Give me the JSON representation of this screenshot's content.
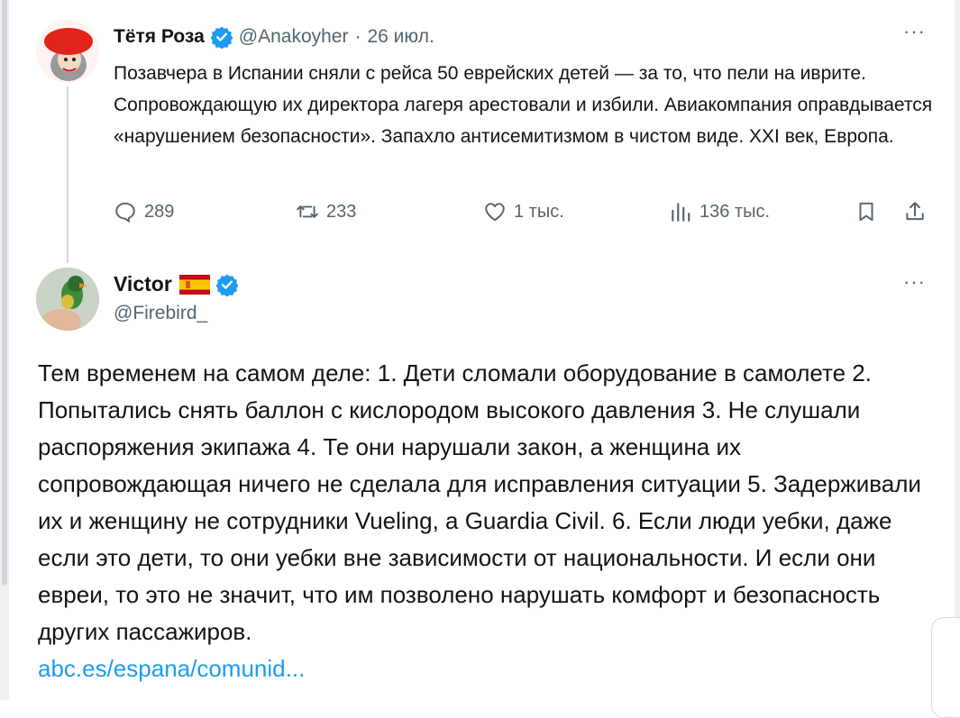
{
  "tweet1": {
    "name": "Тётя Роза",
    "handle": "@Anakoyher",
    "separator": "·",
    "date": "26 июл.",
    "more": "···",
    "text": "Позавчера в  Испании сняли с рейса 50 еврейских детей — за то, что пели на иврите. Сопровождающую их директора лагеря арестовали и избили. Авиакомпания оправдывается «нарушением безопасности». Запахло антисемитизмом в чистом виде. XXI век, Европа.",
    "actions": {
      "replies": "289",
      "reposts": "233",
      "likes": "1 тыс.",
      "views": "136 тыс."
    }
  },
  "tweet2": {
    "name": "Victor",
    "handle": "@Firebird_",
    "more": "···",
    "text": "Тем временем на самом деле: 1. Дети сломали оборудование в самолете 2. Попытались снять баллон с кислородом высокого давления 3. Не слушали распоряжения экипажа 4. Те они нарушали закон, а женщина их сопровождающая ничего не сделала для исправления ситуации 5. Задерживали их и женщину не сотрудники Vueling, а Guardia Civil. 6. Если люди уебки, даже если это дети, то они уебки вне зависимости от национальности. И если они евреи, то это не значит, что им позволено нарушать комфорт и безопасность других пассажиров.",
    "link": "abc.es/espana/comunid..."
  },
  "icons": {
    "verified": "verified-badge-icon",
    "flag": "spain-flag-icon",
    "reply": "reply-icon",
    "repost": "repost-icon",
    "like": "heart-icon",
    "views": "views-chart-icon",
    "bookmark": "bookmark-icon",
    "share": "share-icon"
  },
  "colors": {
    "text": "#0f1419",
    "muted": "#536471",
    "link": "#1d9bf0",
    "verified": "#1d9bf0",
    "thread_line": "#cfd9de"
  }
}
